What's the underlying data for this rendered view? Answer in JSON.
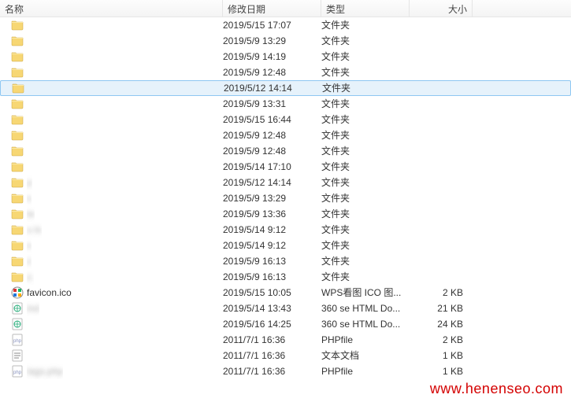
{
  "header": {
    "name": "名称",
    "date": "修改日期",
    "type": "类型",
    "size": "大小"
  },
  "watermark": "www.henenseo.com",
  "rows": [
    {
      "icon": "folder",
      "name": "",
      "blur": true,
      "date": "2019/5/15 17:07",
      "type": "文件夹",
      "size": "",
      "selected": false
    },
    {
      "icon": "folder",
      "name": "",
      "blur": true,
      "date": "2019/5/9 13:29",
      "type": "文件夹",
      "size": "",
      "selected": false
    },
    {
      "icon": "folder",
      "name": "",
      "blur": true,
      "date": "2019/5/9 14:19",
      "type": "文件夹",
      "size": "",
      "selected": false
    },
    {
      "icon": "folder",
      "name": "",
      "blur": true,
      "date": "2019/5/9 12:48",
      "type": "文件夹",
      "size": "",
      "selected": false
    },
    {
      "icon": "folder",
      "name": "",
      "blur": true,
      "date": "2019/5/12 14:14",
      "type": "文件夹",
      "size": "",
      "selected": true
    },
    {
      "icon": "folder",
      "name": "",
      "blur": true,
      "date": "2019/5/9 13:31",
      "type": "文件夹",
      "size": "",
      "selected": false
    },
    {
      "icon": "folder",
      "name": "",
      "blur": true,
      "date": "2019/5/15 16:44",
      "type": "文件夹",
      "size": "",
      "selected": false
    },
    {
      "icon": "folder",
      "name": "",
      "blur": true,
      "date": "2019/5/9 12:48",
      "type": "文件夹",
      "size": "",
      "selected": false
    },
    {
      "icon": "folder",
      "name": "",
      "blur": true,
      "date": "2019/5/9 12:48",
      "type": "文件夹",
      "size": "",
      "selected": false
    },
    {
      "icon": "folder",
      "name": "",
      "blur": true,
      "date": "2019/5/14 17:10",
      "type": "文件夹",
      "size": "",
      "selected": false
    },
    {
      "icon": "folder",
      "name": "p",
      "blur": true,
      "date": "2019/5/12 14:14",
      "type": "文件夹",
      "size": "",
      "selected": false
    },
    {
      "icon": "folder",
      "name": "s",
      "blur": true,
      "date": "2019/5/9 13:29",
      "type": "文件夹",
      "size": "",
      "selected": false
    },
    {
      "icon": "folder",
      "name": "te",
      "blur": true,
      "date": "2019/5/9 13:36",
      "type": "文件夹",
      "size": "",
      "selected": false
    },
    {
      "icon": "folder",
      "name": "u     ls",
      "blur": true,
      "date": "2019/5/14 9:12",
      "type": "文件夹",
      "size": "",
      "selected": false
    },
    {
      "icon": "folder",
      "name": "x",
      "blur": true,
      "date": "2019/5/14 9:12",
      "type": "文件夹",
      "size": "",
      "selected": false
    },
    {
      "icon": "folder",
      "name": "z",
      "blur": true,
      "date": "2019/5/9 16:13",
      "type": "文件夹",
      "size": "",
      "selected": false
    },
    {
      "icon": "folder",
      "name": "z.",
      "blur": true,
      "date": "2019/5/9 16:13",
      "type": "文件夹",
      "size": "",
      "selected": false
    },
    {
      "icon": "ico",
      "name": "favicon.ico",
      "blur": false,
      "date": "2019/5/15 10:05",
      "type": "WPS看图 ICO 图...",
      "size": "2 KB",
      "selected": false
    },
    {
      "icon": "html",
      "name": "ind",
      "blur": true,
      "date": "2019/5/14 13:43",
      "type": "360 se HTML Do...",
      "size": "21 KB",
      "selected": false
    },
    {
      "icon": "html",
      "name": "",
      "blur": true,
      "date": "2019/5/16 14:25",
      "type": "360 se HTML Do...",
      "size": "24 KB",
      "selected": false
    },
    {
      "icon": "php",
      "name": "",
      "blur": true,
      "date": "2011/7/1 16:36",
      "type": "PHPfile",
      "size": "2 KB",
      "selected": false
    },
    {
      "icon": "txt",
      "name": "",
      "blur": true,
      "date": "2011/7/1 16:36",
      "type": "文本文档",
      "size": "1 KB",
      "selected": false
    },
    {
      "icon": "php",
      "name": "tags.php",
      "blur": true,
      "date": "2011/7/1 16:36",
      "type": "PHPfile",
      "size": "1 KB",
      "selected": false
    }
  ]
}
